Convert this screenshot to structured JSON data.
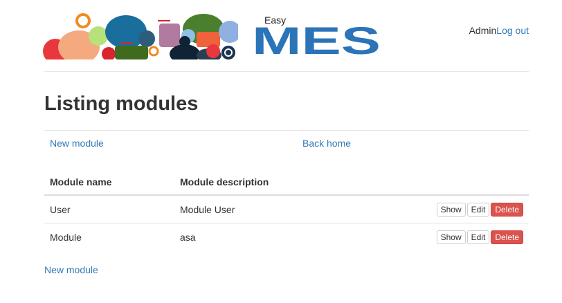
{
  "header": {
    "logo_small_text": "Easy",
    "logo_big_text": "MES",
    "user_name": "Admin",
    "logout_label": "Log out"
  },
  "page": {
    "title": "Listing modules",
    "new_module_label": "New module",
    "back_home_label": "Back home",
    "bottom_new_module_label": "New module"
  },
  "table": {
    "headers": [
      "Module name",
      "Module description",
      ""
    ],
    "rows": [
      {
        "name": "User",
        "description": "Module User",
        "show": "Show",
        "edit": "Edit",
        "delete": "Delete"
      },
      {
        "name": "Module",
        "description": "asa",
        "show": "Show",
        "edit": "Edit",
        "delete": "Delete"
      }
    ]
  },
  "colors": {
    "link": "#337ab7",
    "danger": "#d9534f",
    "logo_blue": "#2b74b8",
    "logo_orange": "#f0623a"
  }
}
